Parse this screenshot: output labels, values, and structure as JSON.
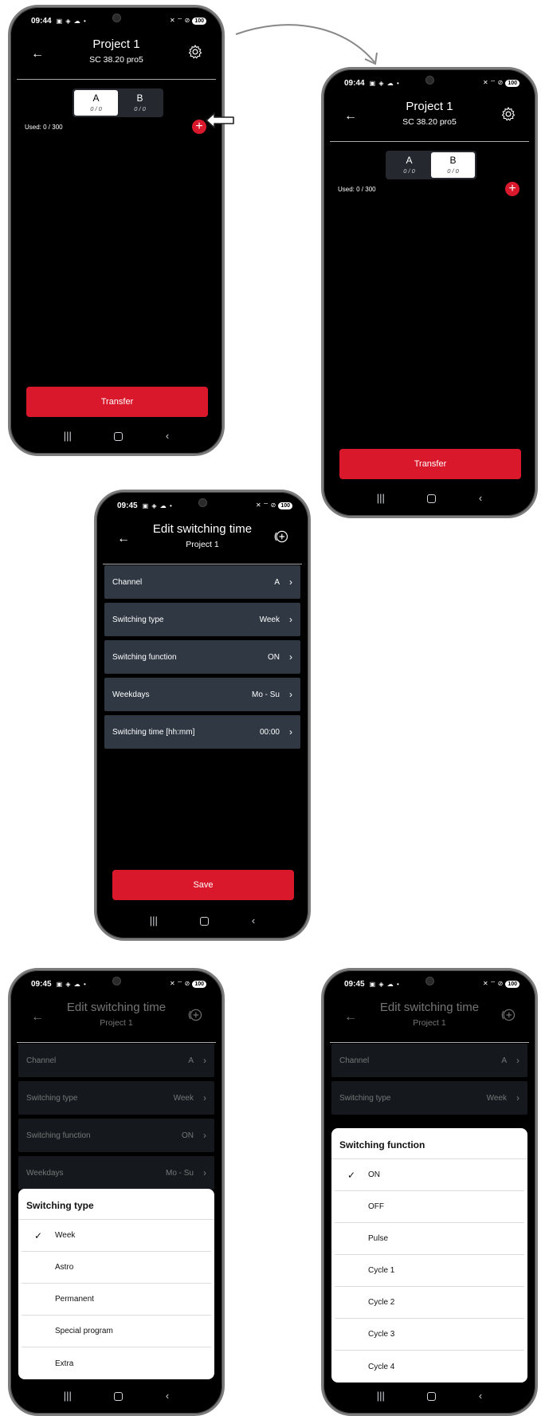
{
  "status": {
    "time1": "09:44",
    "time2": "09:45",
    "battery": "100",
    "icons_left": "▣ ◈ ☁ •",
    "icons_right": "✕ ⌔ ⊘"
  },
  "screen1": {
    "title": "Project 1",
    "subtitle": "SC 38.20 pro5",
    "tabs": [
      {
        "label": "A",
        "count": "0 / 0"
      },
      {
        "label": "B",
        "count": "0 / 0"
      }
    ],
    "active_tab": "A",
    "used": "Used:  0 / 300",
    "transfer": "Transfer"
  },
  "screen2": {
    "title": "Project 1",
    "subtitle": "SC 38.20 pro5",
    "tabs": [
      {
        "label": "A",
        "count": "0 / 0"
      },
      {
        "label": "B",
        "count": "0 / 0"
      }
    ],
    "active_tab": "B",
    "used": "Used:  0 / 300",
    "transfer": "Transfer"
  },
  "edit": {
    "title": "Edit switching time",
    "subtitle": "Project 1",
    "rows": [
      {
        "label": "Channel",
        "value": "A"
      },
      {
        "label": "Switching type",
        "value": "Week"
      },
      {
        "label": "Switching function",
        "value": "ON"
      },
      {
        "label": "Weekdays",
        "value": "Mo - Su"
      },
      {
        "label": "Switching time  [hh:mm]",
        "value": "00:00"
      }
    ],
    "save": "Save"
  },
  "type_sheet": {
    "title": "Switching type",
    "options": [
      "Week",
      "Astro",
      "Permanent",
      "Special program",
      "Extra"
    ],
    "selected": "Week"
  },
  "function_sheet": {
    "title": "Switching function",
    "options": [
      "ON",
      "OFF",
      "Pulse",
      "Cycle 1",
      "Cycle 2",
      "Cycle 3",
      "Cycle 4"
    ],
    "selected": "ON"
  },
  "colors": {
    "accent": "#d9182b",
    "row_bg": "#2f3843",
    "bg": "#000000"
  },
  "icons": {
    "back": "arrow-left-icon",
    "settings": "gear-icon",
    "add": "plus-circle-icon",
    "check": "check-icon",
    "chevron": "chevron-right-icon"
  }
}
